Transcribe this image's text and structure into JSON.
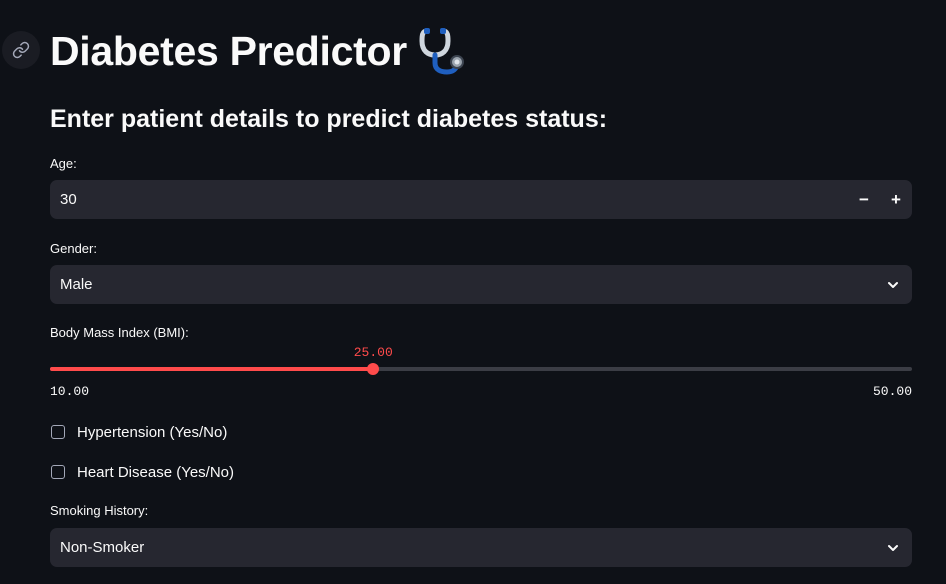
{
  "header": {
    "title": "Diabetes Predictor",
    "title_icon": "stethoscope-icon",
    "anchor_icon": "link-icon"
  },
  "form": {
    "subtitle": "Enter patient details to predict diabetes status:",
    "age": {
      "label": "Age:",
      "value": "30",
      "decrement_label": "−",
      "increment_label": "+"
    },
    "gender": {
      "label": "Gender:",
      "selected": "Male"
    },
    "bmi": {
      "label": "Body Mass Index (BMI):",
      "value": 25.0,
      "value_text": "25.00",
      "min": 10.0,
      "max": 50.0,
      "min_text": "10.00",
      "max_text": "50.00"
    },
    "hypertension": {
      "label": "Hypertension (Yes/No)",
      "checked": false
    },
    "heart_disease": {
      "label": "Heart Disease (Yes/No)",
      "checked": false
    },
    "smoking": {
      "label": "Smoking History:",
      "selected": "Non-Smoker"
    }
  },
  "colors": {
    "background": "#0e1117",
    "input_bg": "#262730",
    "accent": "#ff4b4b",
    "text": "#fafafa"
  }
}
